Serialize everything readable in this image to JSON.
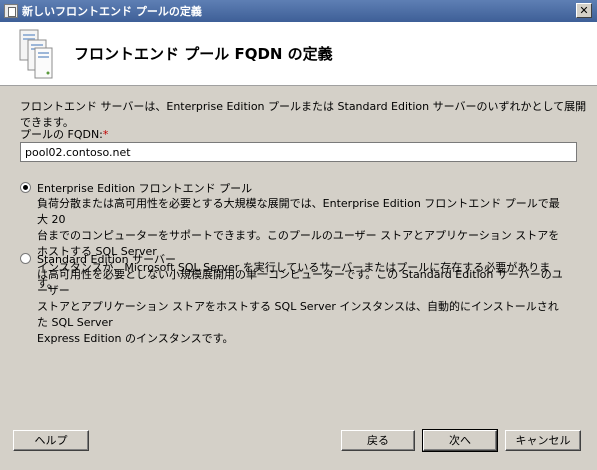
{
  "window": {
    "title": "新しいフロントエンド プールの定義",
    "close_glyph": "✕"
  },
  "header": {
    "title": "フロントエンド プール FQDN の定義",
    "icon": "server-pool-icon"
  },
  "intro": "フロントエンド サーバーは、Enterprise Edition プールまたは Standard Edition サーバーのいずれかとして展開できます。",
  "fqdn": {
    "label": "プールの FQDN:",
    "required_mark": "*",
    "value": "pool02.contoso.net"
  },
  "options": [
    {
      "title": "Enterprise Edition フロントエンド プール",
      "selected": true,
      "desc_lines": [
        "負荷分散または高可用性を必要とする大規模な展開では、Enterprise Edition フロントエンド プールで最大 20",
        "台までのコンピューターをサポートできます。このプールのユーザー ストアとアプリケーション ストアをホストする SQL Server",
        "インスタンスが、Microsoft SQL Server を実行しているサーバーまたはプールに存在する必要があります。"
      ]
    },
    {
      "title": "Standard Edition サーバー",
      "selected": false,
      "desc_lines": [
        "は高可用性を必要としない小規模展開用の単一コンピューターです。この Standard Edition サーバーのユーザー",
        "ストアとアプリケーション ストアをホストする SQL Server インスタンスは、自動的にインストールされた SQL Server",
        "Express Edition のインスタンスです。"
      ]
    }
  ],
  "buttons": {
    "help": "ヘルプ",
    "back": "戻る",
    "next": "次へ",
    "cancel": "キャンセル"
  }
}
